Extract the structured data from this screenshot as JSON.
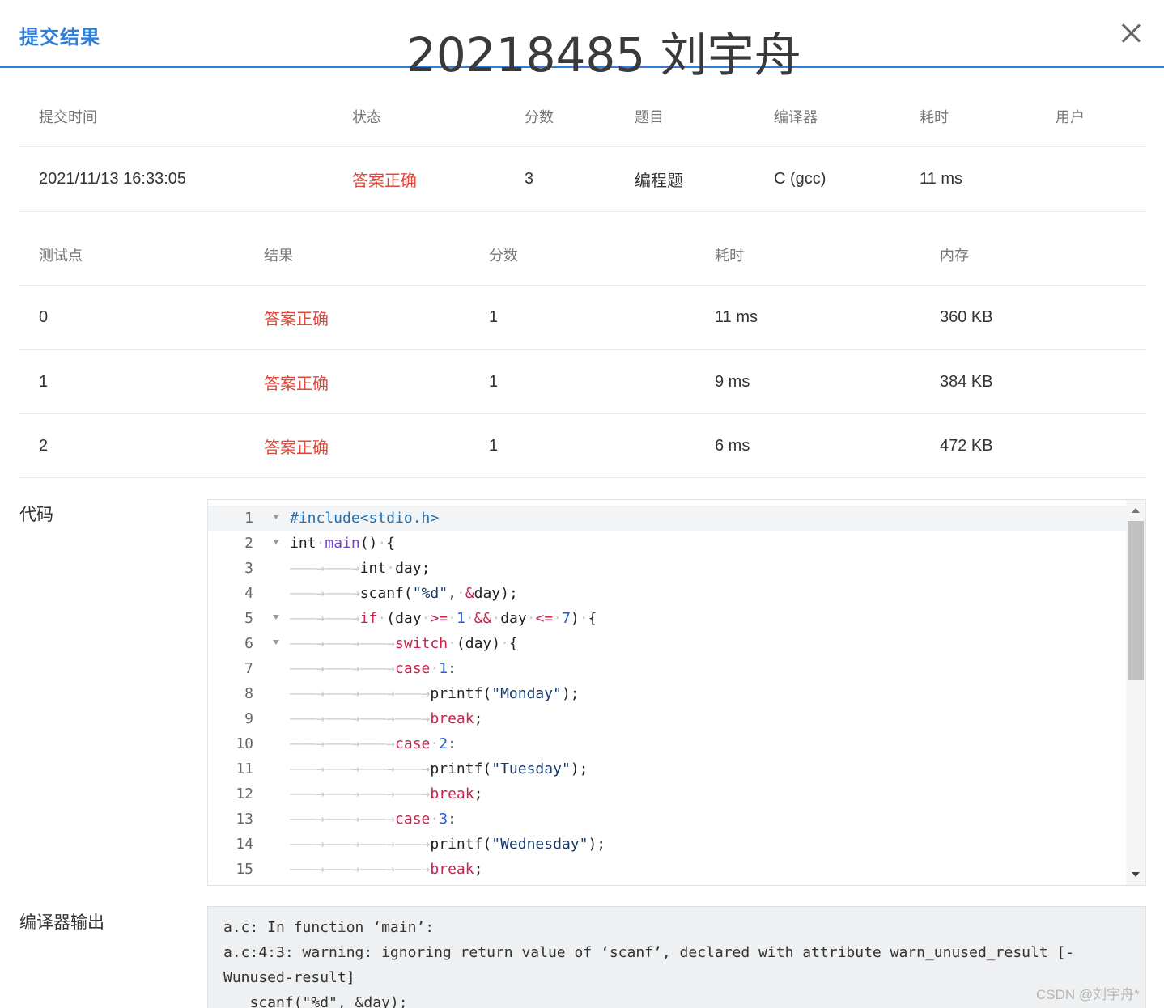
{
  "header": {
    "title": "提交结果",
    "overlay_text": "20218485 刘宇舟"
  },
  "summary": {
    "columns": [
      "提交时间",
      "状态",
      "分数",
      "题目",
      "编译器",
      "耗时",
      "用户"
    ],
    "row": {
      "time": "2021/11/13 16:33:05",
      "status": "答案正确",
      "score": "3",
      "problem": "编程题",
      "compiler": "C (gcc)",
      "elapsed": "11 ms",
      "user": ""
    }
  },
  "tests": {
    "columns": [
      "测试点",
      "结果",
      "分数",
      "耗时",
      "内存"
    ],
    "rows": [
      {
        "id": "0",
        "result": "答案正确",
        "score": "1",
        "time": "11 ms",
        "memory": "360 KB"
      },
      {
        "id": "1",
        "result": "答案正确",
        "score": "1",
        "time": "9 ms",
        "memory": "384 KB"
      },
      {
        "id": "2",
        "result": "答案正确",
        "score": "1",
        "time": "6 ms",
        "memory": "472 KB"
      }
    ]
  },
  "code": {
    "label": "代码",
    "lines": [
      {
        "n": "1",
        "fold": true,
        "tokens": [
          [
            "pp",
            "#include<stdio.h>"
          ]
        ]
      },
      {
        "n": "2",
        "fold": true,
        "tokens": [
          [
            "",
            "int"
          ],
          [
            "dot",
            "·"
          ],
          [
            "fn",
            "main"
          ],
          [
            "",
            "()"
          ],
          [
            "dot",
            "·"
          ],
          [
            "",
            "{"
          ]
        ]
      },
      {
        "n": "3",
        "fold": false,
        "tokens": [
          [
            "tab",
            "———→———→"
          ],
          [
            "",
            "int"
          ],
          [
            "dot",
            "·"
          ],
          [
            "",
            "day;"
          ]
        ]
      },
      {
        "n": "4",
        "fold": false,
        "tokens": [
          [
            "tab",
            "———→———→"
          ],
          [
            "",
            "scanf("
          ],
          [
            "str",
            "\"%d\""
          ],
          [
            "",
            ","
          ],
          [
            "dot",
            "·"
          ],
          [
            "kw",
            "&"
          ],
          [
            "",
            "day);"
          ]
        ]
      },
      {
        "n": "5",
        "fold": true,
        "tokens": [
          [
            "tab",
            "———→———→"
          ],
          [
            "kw",
            "if"
          ],
          [
            "dot",
            "·"
          ],
          [
            "",
            "(day"
          ],
          [
            "dot",
            "·"
          ],
          [
            "kw",
            ">="
          ],
          [
            "dot",
            "·"
          ],
          [
            "num",
            "1"
          ],
          [
            "dot",
            "·"
          ],
          [
            "kw",
            "&&"
          ],
          [
            "dot",
            "·"
          ],
          [
            "",
            "day"
          ],
          [
            "dot",
            "·"
          ],
          [
            "kw",
            "<="
          ],
          [
            "dot",
            "·"
          ],
          [
            "num",
            "7"
          ],
          [
            "",
            ")"
          ],
          [
            "dot",
            "·"
          ],
          [
            "",
            "{"
          ]
        ]
      },
      {
        "n": "6",
        "fold": true,
        "tokens": [
          [
            "tab",
            "———→———→———→"
          ],
          [
            "kw",
            "switch"
          ],
          [
            "dot",
            "·"
          ],
          [
            "",
            "(day)"
          ],
          [
            "dot",
            "·"
          ],
          [
            "",
            "{"
          ]
        ]
      },
      {
        "n": "7",
        "fold": false,
        "tokens": [
          [
            "tab",
            "———→———→———→"
          ],
          [
            "kw",
            "case"
          ],
          [
            "dot",
            "·"
          ],
          [
            "num",
            "1"
          ],
          [
            "",
            ":"
          ]
        ]
      },
      {
        "n": "8",
        "fold": false,
        "tokens": [
          [
            "tab",
            "———→———→———→———→"
          ],
          [
            "",
            "printf("
          ],
          [
            "str",
            "\"Monday\""
          ],
          [
            "",
            ");"
          ]
        ]
      },
      {
        "n": "9",
        "fold": false,
        "tokens": [
          [
            "tab",
            "———→———→———→———→"
          ],
          [
            "kw",
            "break"
          ],
          [
            "",
            ";"
          ]
        ]
      },
      {
        "n": "10",
        "fold": false,
        "tokens": [
          [
            "tab",
            "———→———→———→"
          ],
          [
            "kw",
            "case"
          ],
          [
            "dot",
            "·"
          ],
          [
            "num",
            "2"
          ],
          [
            "",
            ":"
          ]
        ]
      },
      {
        "n": "11",
        "fold": false,
        "tokens": [
          [
            "tab",
            "———→———→———→———→"
          ],
          [
            "",
            "printf("
          ],
          [
            "str",
            "\"Tuesday\""
          ],
          [
            "",
            ");"
          ]
        ]
      },
      {
        "n": "12",
        "fold": false,
        "tokens": [
          [
            "tab",
            "———→———→———→———→"
          ],
          [
            "kw",
            "break"
          ],
          [
            "",
            ";"
          ]
        ]
      },
      {
        "n": "13",
        "fold": false,
        "tokens": [
          [
            "tab",
            "———→———→———→"
          ],
          [
            "kw",
            "case"
          ],
          [
            "dot",
            "·"
          ],
          [
            "num",
            "3"
          ],
          [
            "",
            ":"
          ]
        ]
      },
      {
        "n": "14",
        "fold": false,
        "tokens": [
          [
            "tab",
            "———→———→———→———→"
          ],
          [
            "",
            "printf("
          ],
          [
            "str",
            "\"Wednesday\""
          ],
          [
            "",
            ");"
          ]
        ]
      },
      {
        "n": "15",
        "fold": false,
        "tokens": [
          [
            "tab",
            "———→———→———→———→"
          ],
          [
            "kw",
            "break"
          ],
          [
            "",
            ";"
          ]
        ]
      }
    ]
  },
  "compiler_output": {
    "label": "编译器输出",
    "lines": [
      "a.c: In function ‘main’:",
      "a.c:4:3: warning: ignoring return value of ‘scanf’, declared with attribute warn_unused_result [-",
      "Wunused-result]",
      "   scanf(\"%d\", &day);"
    ]
  },
  "credit": "CSDN @刘宇舟*",
  "colors": {
    "accent": "#2f7fd8",
    "status_ok": "#e0483a"
  }
}
